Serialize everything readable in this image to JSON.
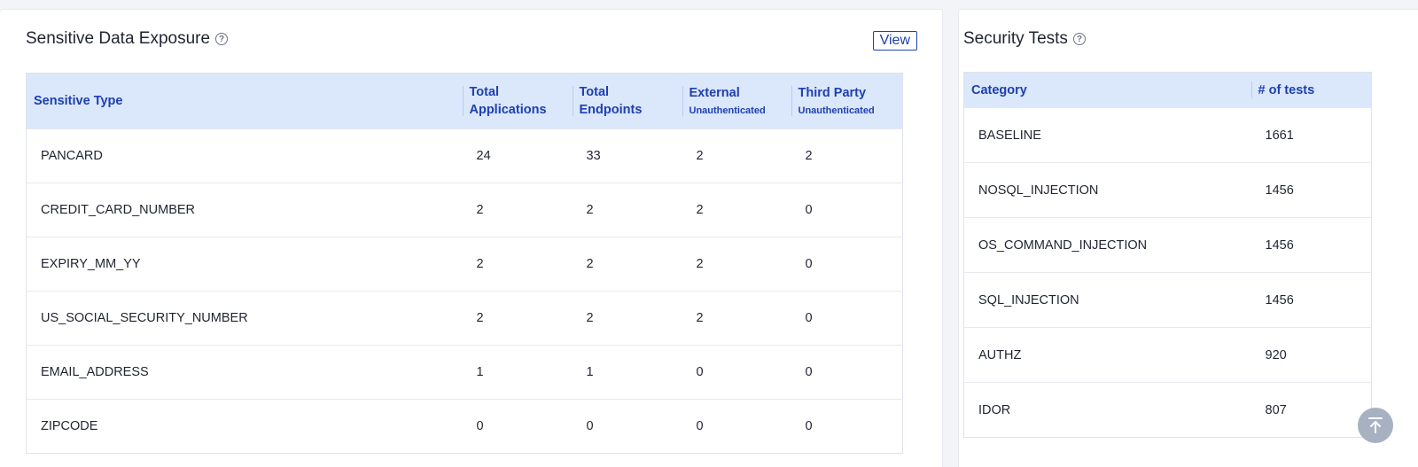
{
  "sensitive": {
    "title": "Sensitive Data Exposure",
    "view_label": "View",
    "headers": {
      "type": "Sensitive Type",
      "apps_line1": "Total",
      "apps_line2": "Applications",
      "endpoints_line1": "Total",
      "endpoints_line2": "Endpoints",
      "external": "External",
      "external_sub": "Unauthenticated",
      "third_party": "Third Party",
      "third_party_sub": "Unauthenticated"
    },
    "rows": [
      {
        "type": "PANCARD",
        "apps": "24",
        "endpoints": "33",
        "external": "2",
        "third_party": "2"
      },
      {
        "type": "CREDIT_CARD_NUMBER",
        "apps": "2",
        "endpoints": "2",
        "external": "2",
        "third_party": "0"
      },
      {
        "type": "EXPIRY_MM_YY",
        "apps": "2",
        "endpoints": "2",
        "external": "2",
        "third_party": "0"
      },
      {
        "type": "US_SOCIAL_SECURITY_NUMBER",
        "apps": "2",
        "endpoints": "2",
        "external": "2",
        "third_party": "0"
      },
      {
        "type": "EMAIL_ADDRESS",
        "apps": "1",
        "endpoints": "1",
        "external": "0",
        "third_party": "0"
      },
      {
        "type": "ZIPCODE",
        "apps": "0",
        "endpoints": "0",
        "external": "0",
        "third_party": "0"
      }
    ]
  },
  "security": {
    "title": "Security Tests",
    "headers": {
      "category": "Category",
      "tests": "# of tests"
    },
    "rows": [
      {
        "category": "BASELINE",
        "tests": "1661"
      },
      {
        "category": "NOSQL_INJECTION",
        "tests": "1456"
      },
      {
        "category": "OS_COMMAND_INJECTION",
        "tests": "1456"
      },
      {
        "category": "SQL_INJECTION",
        "tests": "1456"
      },
      {
        "category": "AUTHZ",
        "tests": "920"
      },
      {
        "category": "IDOR",
        "tests": "807"
      }
    ]
  },
  "icons": {
    "help": "help-circle-icon",
    "scroll_top": "arrow-up-to-line-icon"
  },
  "colors": {
    "header_bg": "#dbe7fb",
    "header_text": "#1e40af",
    "scroll_btn": "#a7b1c2"
  }
}
